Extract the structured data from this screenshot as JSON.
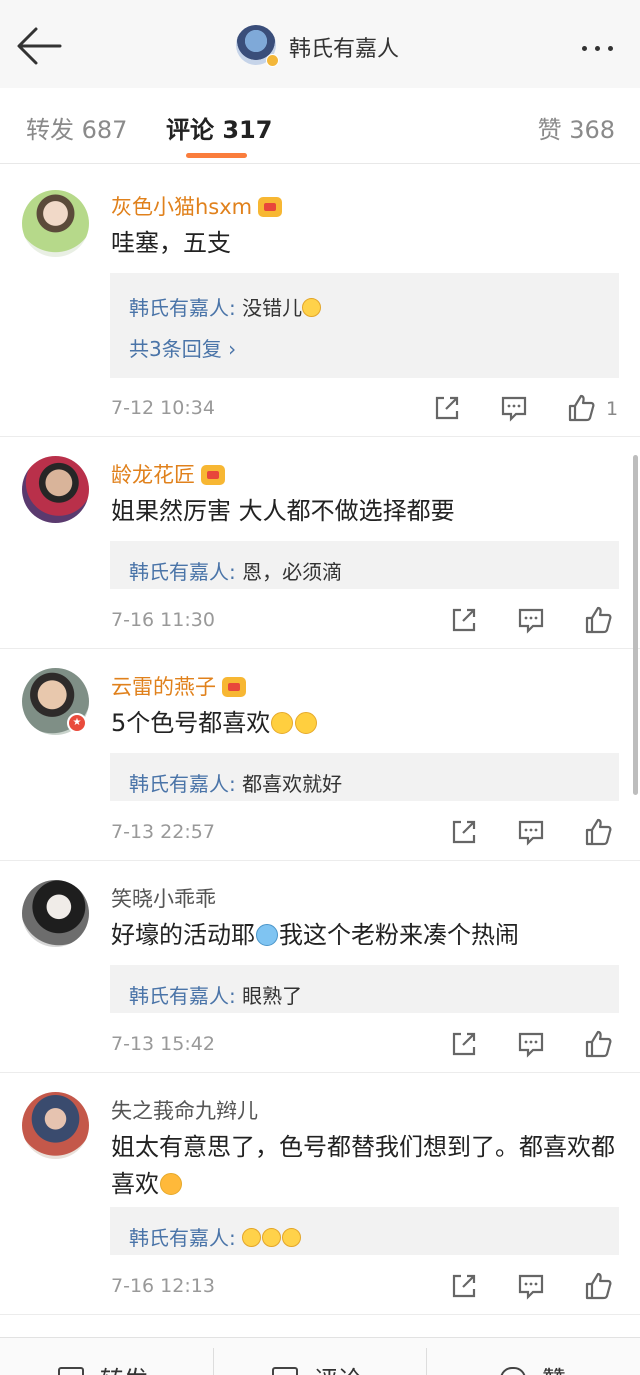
{
  "header": {
    "title": "韩氏有嘉人",
    "back_icon": "arrow-left-icon",
    "more_icon": "more-dots-icon"
  },
  "tabs": {
    "forward": "转发 687",
    "comment": "评论 317",
    "like": "赞 368"
  },
  "comments": [
    {
      "username": "灰色小猫hsxm",
      "vip": true,
      "text": "哇塞，五支",
      "reply": {
        "author": "韩氏有嘉人:",
        "text": " 没错儿",
        "emoji_count": 1
      },
      "more_replies": "共3条回复 ›",
      "time": "7-12 10:34",
      "likes": "1"
    },
    {
      "username": "龄龙花匠",
      "vip": true,
      "text": "姐果然厉害  大人都不做选择都要",
      "reply": {
        "author": "韩氏有嘉人:",
        "text": " 恩，必须滴",
        "emoji_count": 0
      },
      "time": "7-16 11:30",
      "likes": ""
    },
    {
      "username": "云雷的燕子",
      "vip": true,
      "text": "5个色号都喜欢",
      "reply": {
        "author": "韩氏有嘉人:",
        "text": " 都喜欢就好",
        "emoji_count": 0
      },
      "time": "7-13 22:57",
      "likes": ""
    },
    {
      "username": "笑晓小乖乖",
      "vip": false,
      "text_a": "好壕的活动耶",
      "text_b": "我这个老粉来凑个热闹",
      "reply": {
        "author": "韩氏有嘉人:",
        "text": " 眼熟了",
        "emoji_count": 0
      },
      "time": "7-13 15:42",
      "likes": ""
    },
    {
      "username": "失之莪命九辫儿",
      "vip": false,
      "text": "姐太有意思了，色号都替我们想到了。都喜欢都喜欢",
      "reply": {
        "author": "韩氏有嘉人:",
        "text": " ",
        "emoji_count": 3
      },
      "time": "7-16 12:13",
      "likes": ""
    }
  ],
  "bottom_bar": {
    "forward": "转发",
    "comment": "评论",
    "like": "赞"
  },
  "colors": {
    "accent_orange": "#fa7d3c",
    "vip_gold": "#e0811c",
    "link_blue": "#4a74a8"
  }
}
